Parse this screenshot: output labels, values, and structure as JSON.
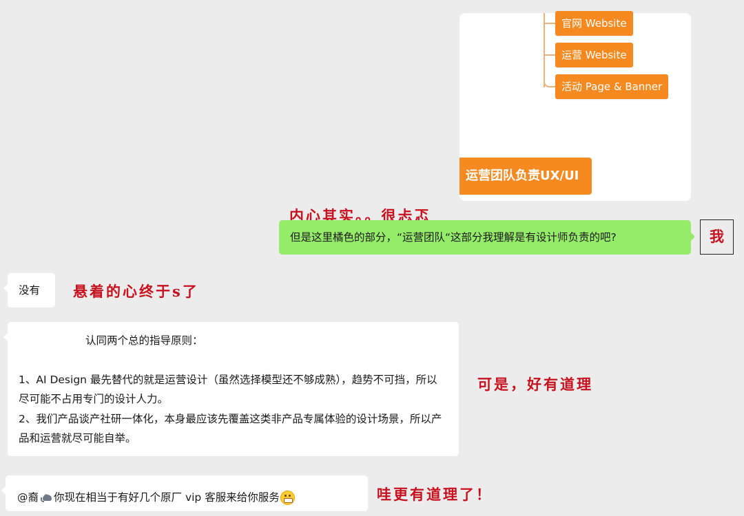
{
  "image_card": {
    "nodes": [
      "官网 Website",
      "运营 Website",
      "活动 Page & Banner"
    ],
    "highlight_node": "运营团队负责UX/UI",
    "accent_color": "#f68a21"
  },
  "messages": {
    "m1": "但是这里橘色的部分，“运营团队“这部分我理解是有设计师负责的吧?",
    "m2": "没有",
    "m3": {
      "title": "认同两个总的指导原则：",
      "p1": "1、AI Design 最先替代的就是运营设计（虽然选择模型还不够成熟），趋势不可挡，所以尽可能不占用专门的设计人力。",
      "p2": "2、我们产品谈产社研一体化，本身最应该先覆盖这类非产品专属体验的设计场景，所以产品和运营就尽可能自举。"
    },
    "m4": {
      "mention": "@裔",
      "text": "你现在相当于有好几个原厂 vip 客服来给你服务"
    }
  },
  "annotations": {
    "a1": "内心其实。。很忐忑",
    "me": "我",
    "a2": "悬着的心终于s了",
    "a3": "可是，好有道理",
    "a4": "哇更有道理了！"
  },
  "colors": {
    "background": "#ececec",
    "bubble_self": "#95ec69",
    "bubble_other": "#ffffff",
    "annotation": "#c8111e"
  },
  "icons": [
    "elephant-emoji-icon",
    "grinning-face-icon"
  ]
}
